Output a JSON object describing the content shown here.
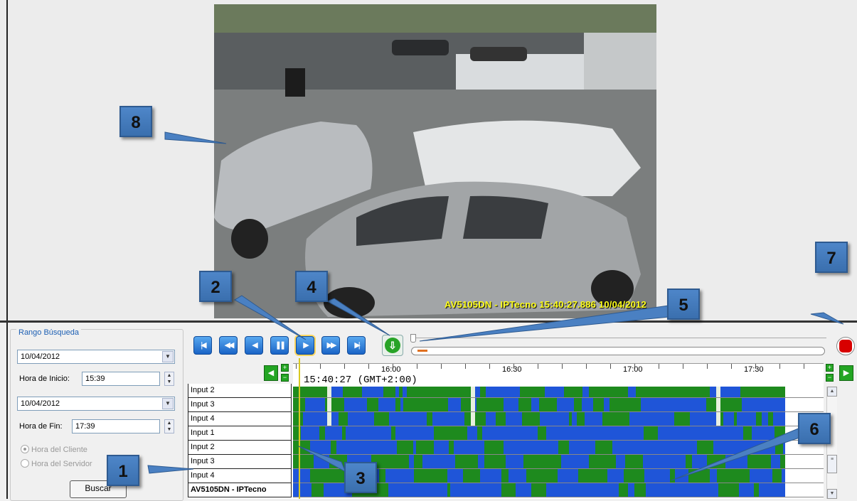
{
  "video": {
    "overlay_text": "AV5105DN - IPTecno 15:40:27.886 10/04/2012"
  },
  "search_range": {
    "title": "Rango Búsqueda",
    "start_date": "10/04/2012",
    "start_time_label": "Hora de Inicio:",
    "start_time": "15:39",
    "end_date": "10/04/2012",
    "end_time_label": "Hora de Fin:",
    "end_time": "17:39",
    "radio_client": "Hora del Cliente",
    "radio_server": "Hora del Servidor",
    "search_button": "Buscar"
  },
  "playback": {
    "buttons": [
      "skip-to-start",
      "fast-rewind",
      "step-back",
      "pause",
      "play",
      "fast-forward",
      "skip-to-end"
    ],
    "active_button": "play"
  },
  "timeline": {
    "current_time": "15:40:27 (GMT+2:00)",
    "hour_labels": [
      "16:00",
      "16:30",
      "17:00",
      "17:30"
    ]
  },
  "channels": [
    {
      "label": "Input 2",
      "pattern": "a"
    },
    {
      "label": "Input 3",
      "pattern": "b"
    },
    {
      "label": "Input 4",
      "pattern": "c"
    },
    {
      "label": "Input 1",
      "pattern": "d"
    },
    {
      "label": "Input 2",
      "pattern": "e"
    },
    {
      "label": "Input 3",
      "pattern": "f"
    },
    {
      "label": "Input 4",
      "pattern": "g"
    },
    {
      "label": "AV5105DN - IPTecno",
      "pattern": "h"
    }
  ],
  "callouts": [
    "1",
    "2",
    "3",
    "4",
    "5",
    "6",
    "7",
    "8"
  ],
  "colors": {
    "motion_green": "#1e8a1e",
    "motion_blue": "#1f55d8",
    "callout_blue": "#4a80c2"
  }
}
